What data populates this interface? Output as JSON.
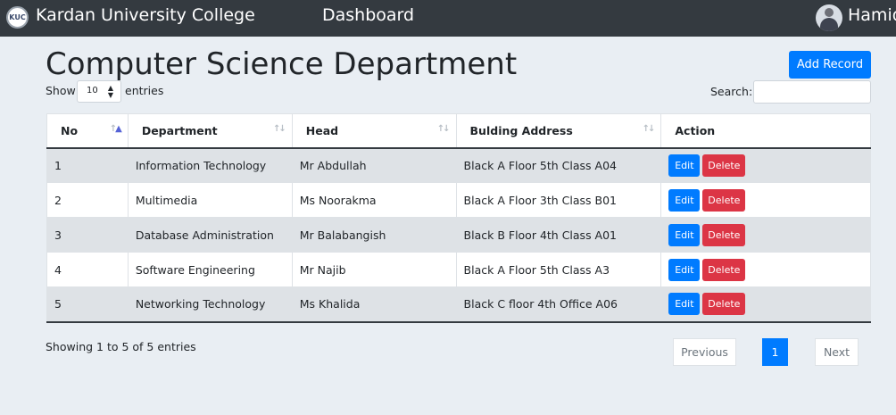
{
  "navbar": {
    "brand": "Kardan University College",
    "nav_link": "Dashboard",
    "user_name": "Hamid"
  },
  "page": {
    "title": "Computer Science Department",
    "add_button": "Add Record"
  },
  "controls": {
    "show_label": "Show",
    "page_length": "10",
    "entries_label": "entries",
    "search_label": "Search:",
    "search_value": ""
  },
  "table": {
    "columns": [
      "No",
      "Department",
      "Head",
      "Bulding Address",
      "Action"
    ],
    "rows": [
      {
        "no": "1",
        "department": "Information Technology",
        "head": "Mr Abdullah",
        "address": "Black A Floor 5th Class A04"
      },
      {
        "no": "2",
        "department": "Multimedia",
        "head": "Ms Noorakma",
        "address": "Black A Floor 3th Class B01"
      },
      {
        "no": "3",
        "department": "Database Administration",
        "head": "Mr Balabangish",
        "address": "Black B Floor 4th Class A01"
      },
      {
        "no": "4",
        "department": "Software Engineering",
        "head": "Mr Najib",
        "address": "Black A Floor 5th Class A3"
      },
      {
        "no": "5",
        "department": "Networking Technology",
        "head": "Ms Khalida",
        "address": "Black C floor 4th Office A06"
      }
    ],
    "edit_label": "Edit",
    "delete_label": "Delete"
  },
  "footer": {
    "info": "Showing 1 to 5 of 5 entries",
    "previous": "Previous",
    "current_page": "1",
    "next": "Next"
  },
  "colors": {
    "navbar": "#343a40",
    "primary": "#007bff",
    "danger": "#dc3545",
    "background": "#e9eef3",
    "striped_row": "#dee2e6"
  },
  "icons": {
    "logo": "university-seal-icon",
    "sort": "sort-arrows-icon",
    "caret": "select-caret-icon"
  }
}
